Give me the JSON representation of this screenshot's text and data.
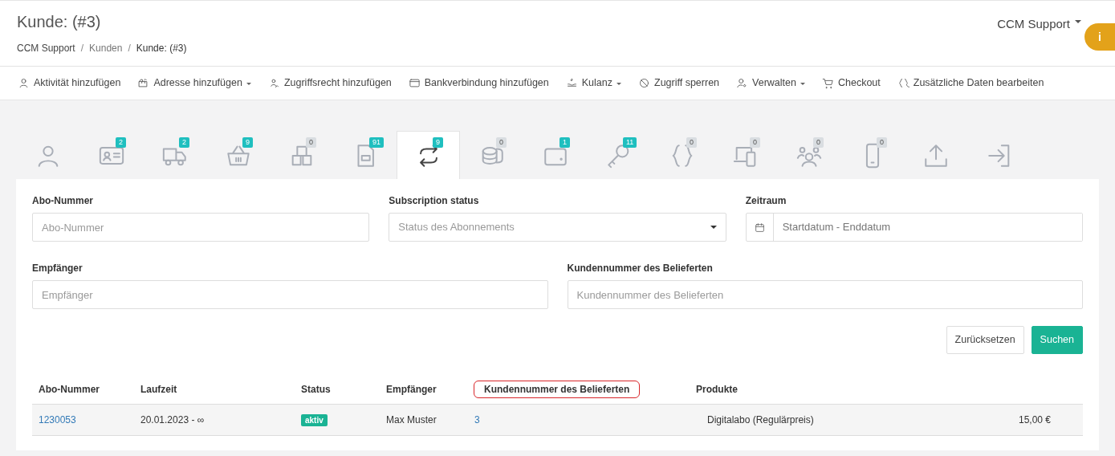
{
  "header": {
    "title": "Kunde: (#3)",
    "breadcrumb": [
      {
        "label": "CCM Support",
        "link": true
      },
      {
        "separator": "/",
        "label": "Kunden",
        "link": true
      },
      {
        "separator": "/",
        "label": "Kunde: (#3)",
        "link": false
      }
    ],
    "user_menu": "CCM Support",
    "info_button": "i"
  },
  "toolbar": [
    {
      "label": "Aktivität hinzufügen",
      "dropdown": false
    },
    {
      "label": "Adresse hinzufügen",
      "dropdown": true
    },
    {
      "label": "Zugriffsrecht hinzufügen",
      "dropdown": false
    },
    {
      "label": "Bankverbindung hinzufügen",
      "dropdown": false
    },
    {
      "label": "Kulanz",
      "dropdown": true
    },
    {
      "label": "Zugriff sperren",
      "dropdown": false
    },
    {
      "label": "Verwalten",
      "dropdown": true
    },
    {
      "label": "Checkout",
      "dropdown": false
    },
    {
      "label": "Zusätzliche Daten bearbeiten",
      "dropdown": false
    }
  ],
  "tabs": [
    {
      "selected": false
    },
    {
      "selected": false,
      "badge": "2",
      "color": "#1fbfbf"
    },
    {
      "selected": false,
      "badge": "2",
      "color": "#1fbfbf"
    },
    {
      "selected": false,
      "badge": "9",
      "color": "#1fbfbf"
    },
    {
      "selected": false,
      "badge": "0",
      "color": "#d9dde1"
    },
    {
      "selected": false,
      "badge": "91",
      "color": "#1fbfbf"
    },
    {
      "selected": true,
      "badge": "9",
      "color": "#1fbfbf"
    },
    {
      "selected": false,
      "badge": "0",
      "color": "#d9dde1"
    },
    {
      "selected": false,
      "badge": "1",
      "color": "#1fbfbf"
    },
    {
      "selected": false,
      "badge": "11",
      "color": "#1fbfbf"
    },
    {
      "selected": false,
      "badge": "0",
      "color": "#d9dde1"
    },
    {
      "selected": false,
      "badge": "0",
      "color": "#d9dde1"
    },
    {
      "selected": false,
      "badge": "0",
      "color": "#d9dde1"
    },
    {
      "selected": false,
      "badge": "0",
      "color": "#d9dde1"
    },
    {
      "selected": false
    },
    {
      "selected": false
    }
  ],
  "filters": [
    {
      "label": "Abo-Nummer",
      "kind": "text",
      "placeholder": "Abo-Nummer"
    },
    {
      "label": "Subscription status",
      "kind": "select",
      "placeholder": "Status des Abonnements"
    },
    {
      "label": "Zeitraum",
      "kind": "date",
      "placeholder": "Startdatum - Enddatum"
    },
    {
      "label": "Empfänger",
      "kind": "text",
      "placeholder": "Empfänger"
    },
    {
      "label": "Kundennummer des Belieferten",
      "kind": "text",
      "placeholder": "Kundennummer des Belieferten"
    }
  ],
  "buttons": [
    {
      "label": "Zurücksetzen",
      "kind": "secondary"
    },
    {
      "label": "Suchen",
      "kind": "primary"
    }
  ],
  "table": {
    "columns": [
      {
        "label": "Abo-Nummer",
        "highlighted": false
      },
      {
        "label": "Laufzeit",
        "highlighted": false
      },
      {
        "label": "Status",
        "highlighted": false
      },
      {
        "label": "Empfänger",
        "highlighted": false
      },
      {
        "label": "Kundennummer des Belieferten",
        "highlighted": true
      },
      {
        "label": "Produkte",
        "highlighted": false
      }
    ],
    "rows": [
      {
        "abo_nummer": "1230053",
        "laufzeit": "20.01.2023  - ∞",
        "status": "aktiv",
        "empfaenger": "Max Muster",
        "kundennummer": "3",
        "produkt": "Digitalabo (Regulärpreis)",
        "preis": "15,00 €"
      }
    ]
  }
}
